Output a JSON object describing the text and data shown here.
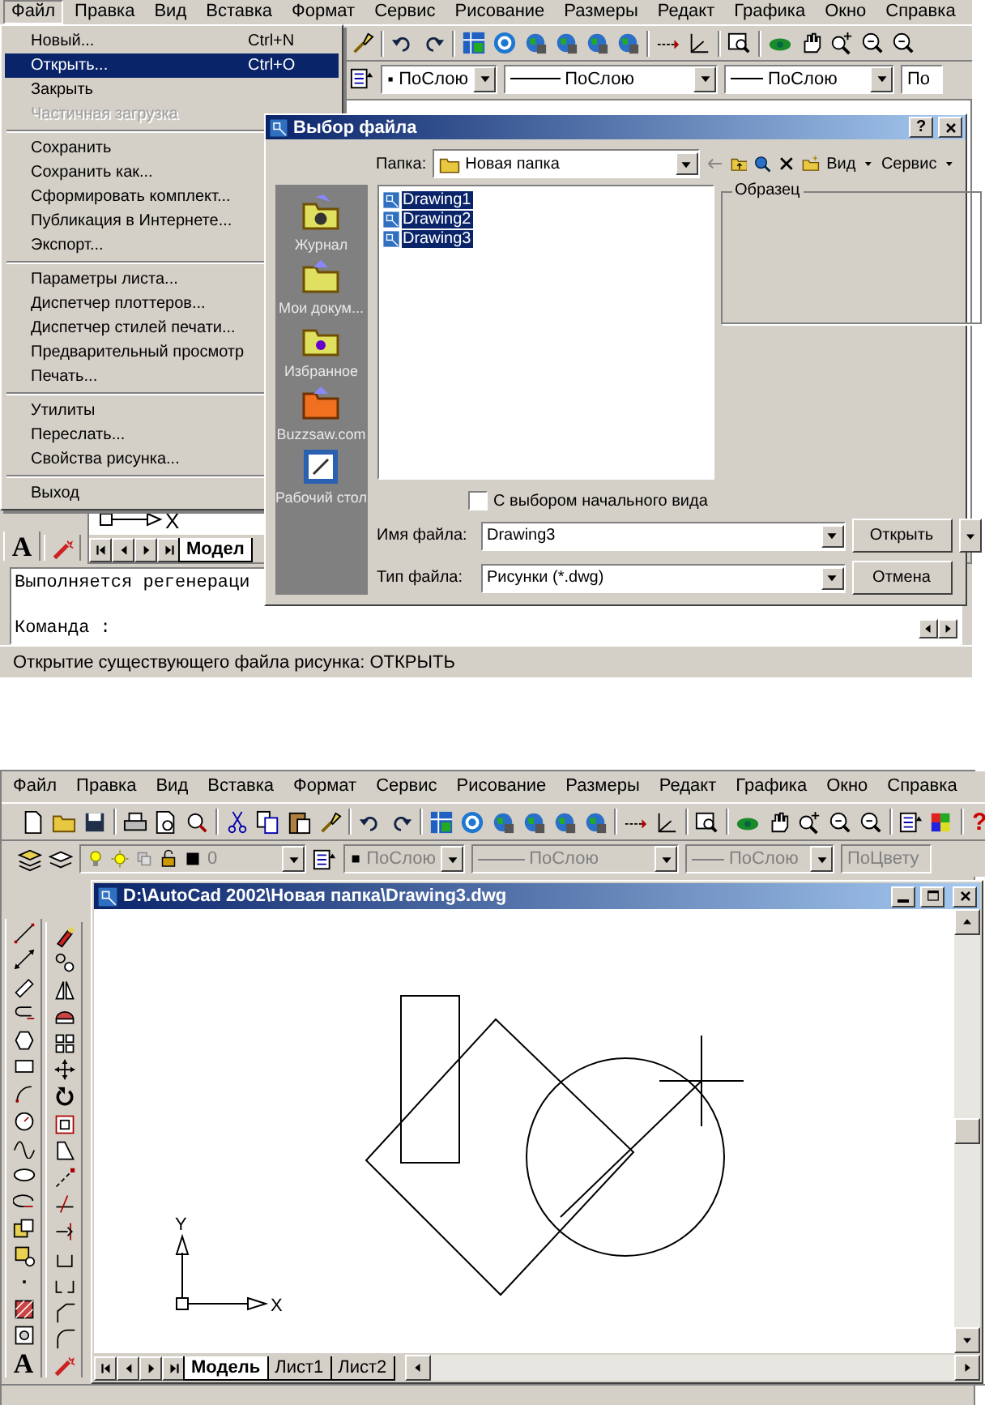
{
  "top_screen": {
    "menu_bar": [
      {
        "label": "Файл",
        "selected": true
      },
      {
        "label": "Правка",
        "selected": false
      },
      {
        "label": "Вид",
        "selected": false
      },
      {
        "label": "Вставка",
        "selected": false
      },
      {
        "label": "Формат",
        "selected": false
      },
      {
        "label": "Сервис",
        "selected": false
      },
      {
        "label": "Рисование",
        "selected": false
      },
      {
        "label": "Размеры",
        "selected": false
      },
      {
        "label": "Редакт",
        "selected": false
      },
      {
        "label": "Графика",
        "selected": false
      },
      {
        "label": "Окно",
        "selected": false
      },
      {
        "label": "Справка",
        "selected": false
      }
    ],
    "property_bar": {
      "disabled": false,
      "color_setting": "ПоСлою",
      "linetype": "ПоСлою",
      "lineweight": "ПоСлою",
      "plot_style": "По"
    },
    "file_menu": [
      [
        {
          "label": "Новый...",
          "shortcut": "Ctrl+N",
          "selected": false,
          "disabled": false
        },
        {
          "label": "Открыть...",
          "shortcut": "Ctrl+O",
          "selected": true,
          "disabled": false
        },
        {
          "label": "Закрыть",
          "selected": false,
          "disabled": false
        },
        {
          "label": "Частичная загрузка",
          "selected": false,
          "disabled": true
        }
      ],
      [
        {
          "label": "Сохранить",
          "selected": false,
          "disabled": false
        },
        {
          "label": "Сохранить как...",
          "selected": false,
          "disabled": false
        },
        {
          "label": "Сформировать комплект...",
          "selected": false,
          "disabled": false
        },
        {
          "label": "Публикация в Интернете...",
          "selected": false,
          "disabled": false
        },
        {
          "label": "Экспорт...",
          "selected": false,
          "disabled": false
        }
      ],
      [
        {
          "label": "Параметры листа...",
          "selected": false,
          "disabled": false
        },
        {
          "label": "Диспетчер плоттеров...",
          "selected": false,
          "disabled": false
        },
        {
          "label": "Диспетчер стилей печати...",
          "selected": false,
          "disabled": false
        },
        {
          "label": "Предварительный просмотр",
          "selected": false,
          "disabled": false
        },
        {
          "label": "Печать...",
          "selected": false,
          "disabled": false
        }
      ],
      [
        {
          "label": "Утилиты",
          "selected": false,
          "disabled": false
        },
        {
          "label": "Переслать...",
          "selected": false,
          "disabled": false
        },
        {
          "label": "Свойства рисунка...",
          "selected": false,
          "disabled": false
        }
      ],
      [
        {
          "label": "Выход",
          "selected": false,
          "disabled": false
        }
      ]
    ],
    "file_dialog": {
      "title": "Выбор файла",
      "help_button": "?",
      "folder_label": "Папка:",
      "folder": "Новая папка",
      "view_menu": "Вид",
      "tools_menu": "Сервис",
      "places": [
        {
          "label": "Журнал"
        },
        {
          "label": "Мои докум..."
        },
        {
          "label": "Избранное"
        },
        {
          "label": "Buzzsaw.com"
        },
        {
          "label": "Рабочий стол"
        }
      ],
      "files": [
        {
          "name": "Drawing1",
          "selected": true
        },
        {
          "name": "Drawing2",
          "selected": true
        },
        {
          "name": "Drawing3",
          "selected": true
        }
      ],
      "preview_label": "Образец",
      "initial_view_checkbox": {
        "label": "С выбором начального вида",
        "checked": false
      },
      "file_name_label": "Имя файла:",
      "file_name": "Drawing3",
      "file_type_label": "Тип файла:",
      "file_type": "Рисунки (*.dwg)",
      "open_button": "Открыть",
      "cancel_button": "Отмена"
    },
    "text_tool": "A",
    "ucs_x": "X",
    "layout_tabs": [
      {
        "label": "Модел",
        "selected": true
      }
    ],
    "command_lines": [
      "Выполняется регенераци",
      "Команда :"
    ],
    "status_bar": "Открытие существующего файла рисунка:  ОТКРЫТЬ"
  },
  "bottom_screen": {
    "menu_bar": [
      {
        "label": "Файл",
        "selected": false
      },
      {
        "label": "Правка",
        "selected": false
      },
      {
        "label": "Вид",
        "selected": false
      },
      {
        "label": "Вставка",
        "selected": false
      },
      {
        "label": "Формат",
        "selected": false
      },
      {
        "label": "Сервис",
        "selected": false
      },
      {
        "label": "Рисование",
        "selected": false
      },
      {
        "label": "Размеры",
        "selected": false
      },
      {
        "label": "Редакт",
        "selected": false
      },
      {
        "label": "Графика",
        "selected": false
      },
      {
        "label": "Окно",
        "selected": false
      },
      {
        "label": "Справка",
        "selected": false
      }
    ],
    "help_tool": "?",
    "layer": {
      "name": "0",
      "disabled": true
    },
    "property_bar": {
      "disabled": true,
      "color_setting": "ПоСлою",
      "linetype": "ПоСлою",
      "lineweight": "ПоСлою",
      "plot_style": "ПоЦвету"
    },
    "text_tool": "A",
    "drawing_window": {
      "title": "D:\\AutoCad 2002\\Новая папка\\Drawing3.dwg",
      "ucs_x": "X",
      "ucs_y": "Y",
      "layout_tabs": [
        {
          "label": "Модель",
          "selected": true
        },
        {
          "label": "Лист1",
          "selected": false
        },
        {
          "label": "Лист2",
          "selected": false
        }
      ]
    }
  }
}
